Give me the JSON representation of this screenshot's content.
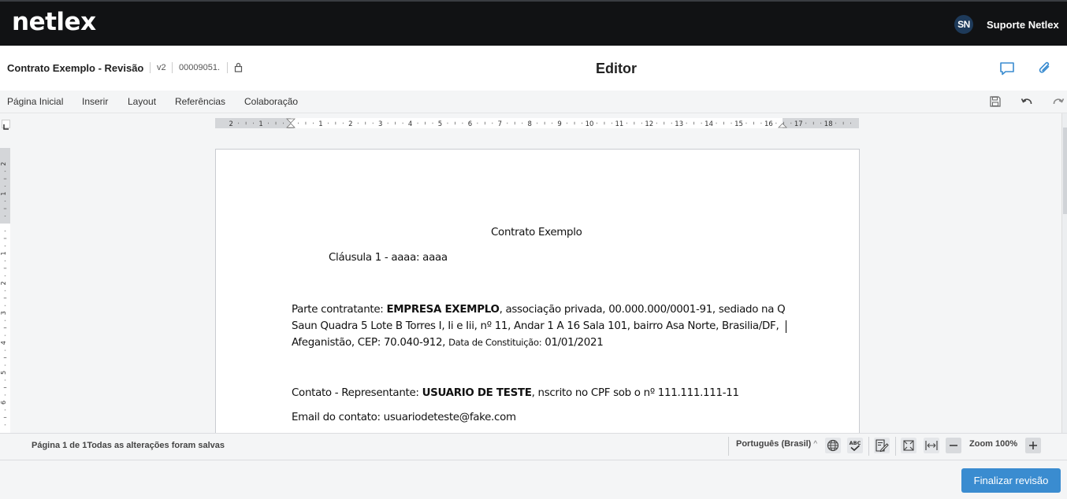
{
  "app": {
    "logo": "netlex",
    "user_initials": "SN",
    "user_name": "Suporte Netlex"
  },
  "document": {
    "title": "Contrato Exemplo - Revisão",
    "version": "v2",
    "number": "00009051."
  },
  "header": {
    "center_title": "Editor"
  },
  "menu": {
    "items": [
      "Página Inicial",
      "Inserir",
      "Layout",
      "Referências",
      "Colaboração"
    ]
  },
  "ruler": {
    "labels": [
      "2",
      "1",
      "",
      "1",
      "2",
      "3",
      "4",
      "5",
      "6",
      "7",
      "8",
      "9",
      "10",
      "11",
      "12",
      "13",
      "14",
      "15",
      "16",
      "17",
      "18"
    ]
  },
  "content": {
    "heading": "Contrato Exemplo",
    "clause": "Cláusula 1 - aaaa: aaaa",
    "party_prefix": "Parte contratante: ",
    "party_name": "EMPRESA EXEMPLO",
    "party_line1_rest": ", associação privada, 00.000.000/0001-91, sediado na Q",
    "party_line2": "Saun Quadra 5 Lote B Torres I, Ii e Iii, nº 11, Andar 1 A 16 Sala 101, bairro Asa Norte, Brasilia/DF,",
    "party_line3_a": "Afeganistão, CEP: 70.040-912, ",
    "party_line3_b": "Data de Constituição:",
    "party_line3_c": " 01/01/2021",
    "contact_prefix": "Contato - Representante: ",
    "contact_name": "USUARIO DE TESTE",
    "contact_rest": ", nscrito no CPF sob o nº 111.111.111-11",
    "email_line": "Email do contato: usuariodeteste@fake.com"
  },
  "status": {
    "page_info": "Página 1 de 1",
    "save_info": "Todas as alterações foram salvas",
    "language": "Português (Brasil)",
    "zoom": "Zoom 100%"
  },
  "footer": {
    "finalize_label": "Finalizar revisão"
  }
}
